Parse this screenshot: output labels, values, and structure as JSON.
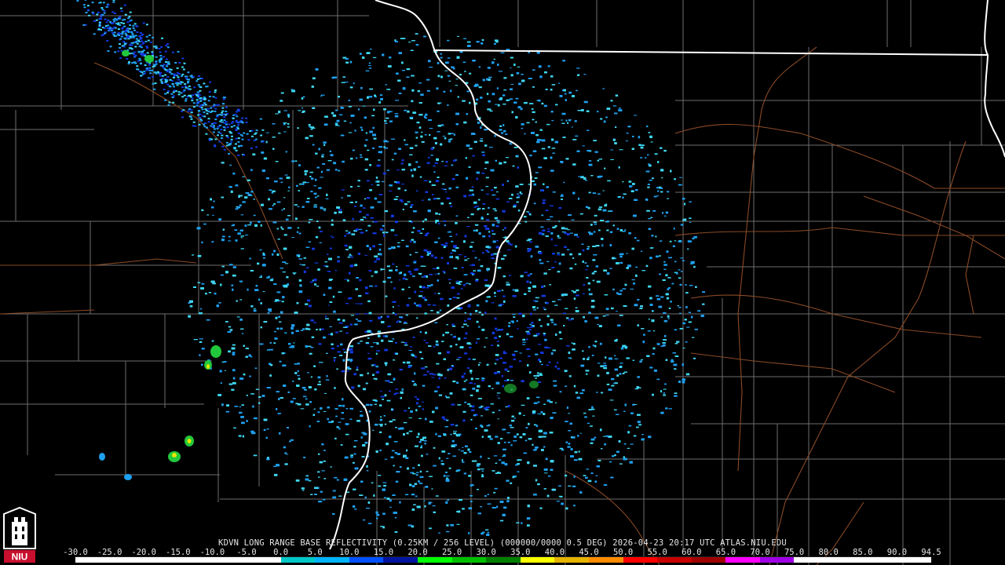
{
  "caption": "KDVN LONG RANGE BASE REFLECTIVITY (0.25KM / 256 LEVEL) (000000/0000 0.5 DEG) 2026-04-23 20:17 UTC  ATLAS.NIU.EDU",
  "logo": {
    "text": "NIU",
    "icon": "niu-tower-logo-icon"
  },
  "colorbar": {
    "ticks": [
      "-30.0",
      "-25.0",
      "-20.0",
      "-15.0",
      "-10.0",
      "-5.0",
      "0.0",
      "5.0",
      "10.0",
      "15.0",
      "20.0",
      "25.0",
      "30.0",
      "35.0",
      "40.0",
      "45.0",
      "50.0",
      "55.0",
      "60.0",
      "65.0",
      "70.0",
      "75.0",
      "80.0",
      "85.0",
      "90.0",
      "94.5"
    ],
    "colors": [
      "#ffffff",
      "#ffffff",
      "#ffffff",
      "#ffffff",
      "#ffffff",
      "#ffffff",
      "#00c8c8",
      "#00b4ff",
      "#0050ff",
      "#0014a0",
      "#00ff00",
      "#00c000",
      "#008000",
      "#ffff00",
      "#e6b400",
      "#ff8c00",
      "#ff0000",
      "#c80000",
      "#a00000",
      "#ff00ff",
      "#a000e6",
      "#ffffff",
      "#ffffff",
      "#ffffff",
      "#ffffff"
    ]
  },
  "colors": {
    "background": "#000000",
    "county_lines": "#6e6e6e",
    "state_lines": "#ffffff",
    "roads": "#8a4a26",
    "echo_light": "#3fd8f2",
    "echo_mid": "#1fa0f0",
    "echo_dark": "#1238e0",
    "echo_green": "#22c83c",
    "echo_yellow": "#e6e600"
  }
}
